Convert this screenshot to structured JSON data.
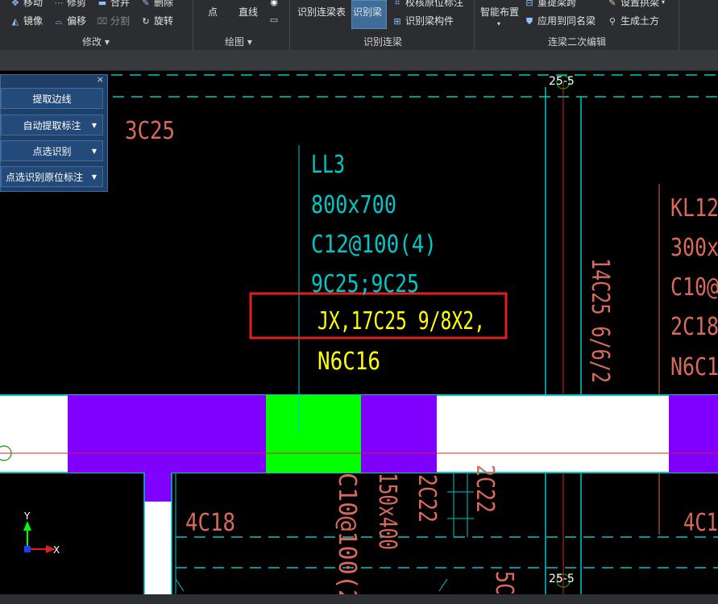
{
  "ribbon": {
    "modify": {
      "row1": [
        "移动",
        "修剪",
        "合并",
        "删除"
      ],
      "row2": [
        "镜像",
        "偏移",
        "分割",
        "旋转"
      ],
      "group": "修改"
    },
    "draw": {
      "items": [
        "点",
        "直线"
      ],
      "group": "绘图"
    },
    "recognize": {
      "table_button": "识别连梁表",
      "beam_button": "识别梁",
      "check_label": "校核原位标注",
      "component_label": "识别梁构件",
      "group": "识别连梁"
    },
    "secondary": {
      "smart_layout": "智能布置",
      "reextract": "重提梁跨",
      "apply_same": "应用到同名梁",
      "set_arch": "设置拱梁",
      "gen_earth": "生成土方",
      "group": "连梁二次编辑"
    }
  },
  "panel": {
    "close": "×",
    "buttons": [
      "提取边线",
      "自动提取标注",
      "点选识别",
      "点选识别原位标注"
    ]
  },
  "drawing": {
    "axis_top": "25-5",
    "axis_bottom": "25-5",
    "top_left_label": "3C25",
    "ll3": [
      "LL3",
      "800x700",
      "C12@100(4)",
      "9C25;9C25"
    ],
    "highlight": "JX,17C25 9/8X2,",
    "n6c16": "N6C16",
    "kl": [
      "KL12",
      "300x",
      "C10@",
      "2C18",
      "N6C1"
    ],
    "vertical_14c25": "14C25 6/6/2",
    "bottom_4c18": "4C18",
    "bottom_right_4c1": "4C1",
    "v_c10": "C10@100(2",
    "v_150x400": "150x400",
    "v_2c22_a": "2C22",
    "v_2c22_b": "2C22",
    "bottom_5c": "5C",
    "ucs_x": "X",
    "ucs_y": "Y"
  },
  "colors": {
    "cyan": "#00c8c8",
    "yellow": "#ffff00",
    "salmon": "#d96a5a",
    "purple": "#8000ff",
    "green": "#00ff00",
    "red_highlight": "#e02020"
  }
}
